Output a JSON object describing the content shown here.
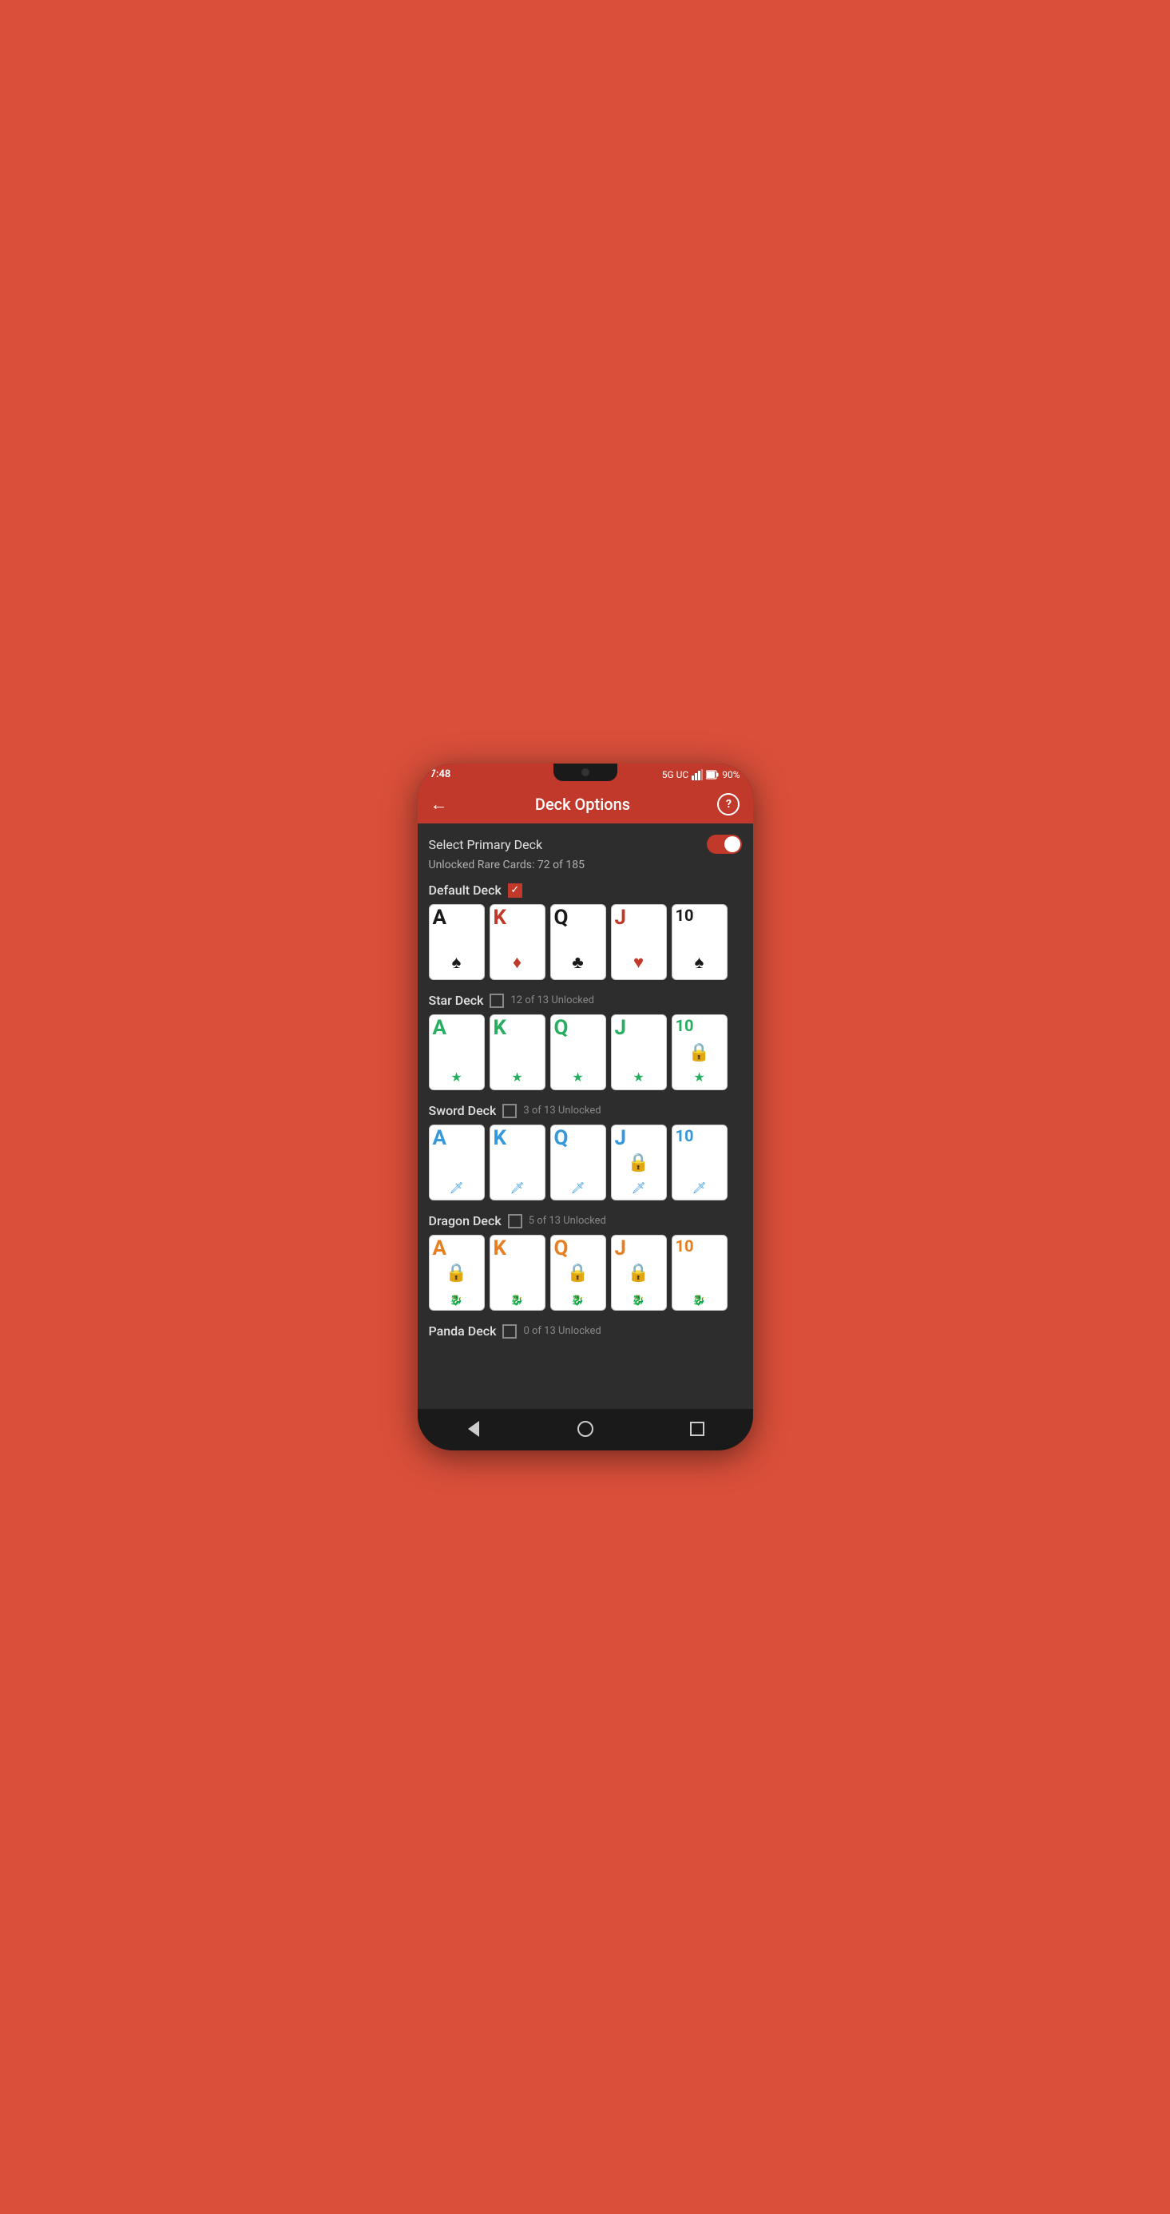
{
  "statusBar": {
    "time": "7:48",
    "signal": "5G UC",
    "battery": "90%"
  },
  "appBar": {
    "title": "Deck Options",
    "backLabel": "←",
    "helpLabel": "?"
  },
  "page": {
    "selectPrimaryDeck": "Select Primary Deck",
    "unlockedRareCards": "Unlocked Rare Cards: 72 of 185",
    "toggleOn": true
  },
  "decks": [
    {
      "name": "Default Deck",
      "checked": true,
      "unlockText": "",
      "cards": [
        {
          "letter": "A",
          "suit": "spade",
          "color": "black",
          "locked": false
        },
        {
          "letter": "K",
          "suit": "diamond",
          "color": "red",
          "locked": false
        },
        {
          "letter": "Q",
          "suit": "club",
          "color": "black",
          "locked": false
        },
        {
          "letter": "J",
          "suit": "heart",
          "color": "red",
          "locked": false
        },
        {
          "letter": "10",
          "suit": "spade",
          "color": "black",
          "locked": false
        }
      ]
    },
    {
      "name": "Star Deck",
      "checked": false,
      "unlockText": "12 of 13 Unlocked",
      "cards": [
        {
          "letter": "A",
          "suit": "star",
          "color": "green",
          "locked": false
        },
        {
          "letter": "K",
          "suit": "star",
          "color": "green",
          "locked": false
        },
        {
          "letter": "Q",
          "suit": "star",
          "color": "green",
          "locked": false
        },
        {
          "letter": "J",
          "suit": "star",
          "color": "green",
          "locked": false
        },
        {
          "letter": "10",
          "suit": "star",
          "color": "green",
          "locked": true
        }
      ]
    },
    {
      "name": "Sword Deck",
      "checked": false,
      "unlockText": "3 of 13 Unlocked",
      "cards": [
        {
          "letter": "A",
          "suit": "sword",
          "color": "blue",
          "locked": false
        },
        {
          "letter": "K",
          "suit": "sword",
          "color": "blue",
          "locked": false
        },
        {
          "letter": "Q",
          "suit": "sword",
          "color": "blue",
          "locked": false
        },
        {
          "letter": "J",
          "suit": "sword",
          "color": "blue",
          "locked": true
        },
        {
          "letter": "10",
          "suit": "sword",
          "color": "blue",
          "locked": false
        }
      ]
    },
    {
      "name": "Dragon Deck",
      "checked": false,
      "unlockText": "5 of 13 Unlocked",
      "cards": [
        {
          "letter": "A",
          "suit": "dragon",
          "color": "orange",
          "locked": true
        },
        {
          "letter": "K",
          "suit": "dragon",
          "color": "orange",
          "locked": false
        },
        {
          "letter": "Q",
          "suit": "dragon",
          "color": "orange",
          "locked": true
        },
        {
          "letter": "J",
          "suit": "dragon",
          "color": "orange",
          "locked": true
        },
        {
          "letter": "10",
          "suit": "dragon",
          "color": "orange",
          "locked": false
        }
      ]
    },
    {
      "name": "Panda Deck",
      "checked": false,
      "unlockText": "0 of 13 Unlocked",
      "cards": []
    }
  ],
  "bottomNav": {
    "back": "back",
    "home": "home",
    "recents": "recents"
  }
}
